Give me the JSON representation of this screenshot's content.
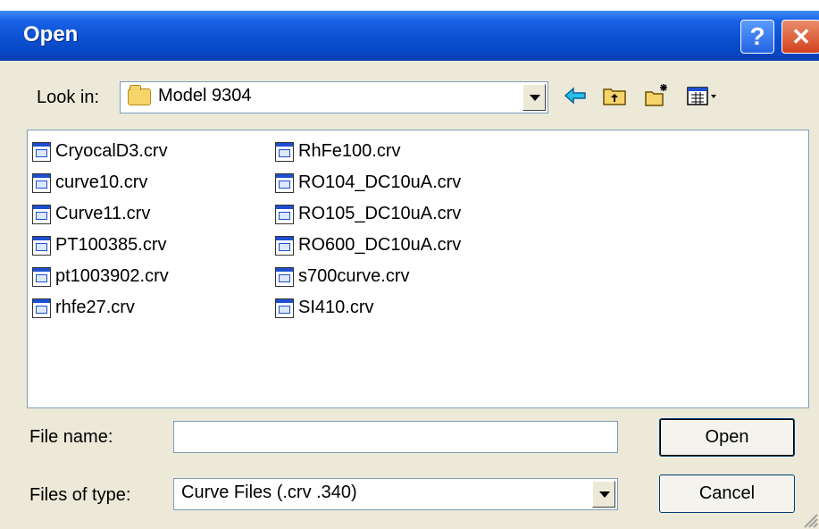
{
  "dialog": {
    "title": "Open",
    "help_label": "?",
    "close_label": "✕"
  },
  "look_in": {
    "label": "Look in:",
    "value": "Model 9304"
  },
  "toolbar": {
    "icons": [
      "back-icon",
      "up-one-level-icon",
      "new-folder-icon",
      "view-menu-icon"
    ]
  },
  "files": [
    {
      "name": "CryocalD3.crv"
    },
    {
      "name": "curve10.crv"
    },
    {
      "name": "Curve11.crv"
    },
    {
      "name": "PT100385.crv"
    },
    {
      "name": "pt1003902.crv"
    },
    {
      "name": "rhfe27.crv"
    },
    {
      "name": "RhFe100.crv"
    },
    {
      "name": "RO104_DC10uA.crv"
    },
    {
      "name": "RO105_DC10uA.crv"
    },
    {
      "name": "RO600_DC10uA.crv"
    },
    {
      "name": "s700curve.crv"
    },
    {
      "name": "SI410.crv"
    }
  ],
  "file_name": {
    "label": "File name:",
    "value": ""
  },
  "file_type": {
    "label": "Files of type:",
    "value": "Curve Files (.crv .340)"
  },
  "buttons": {
    "open": "Open",
    "cancel": "Cancel"
  }
}
